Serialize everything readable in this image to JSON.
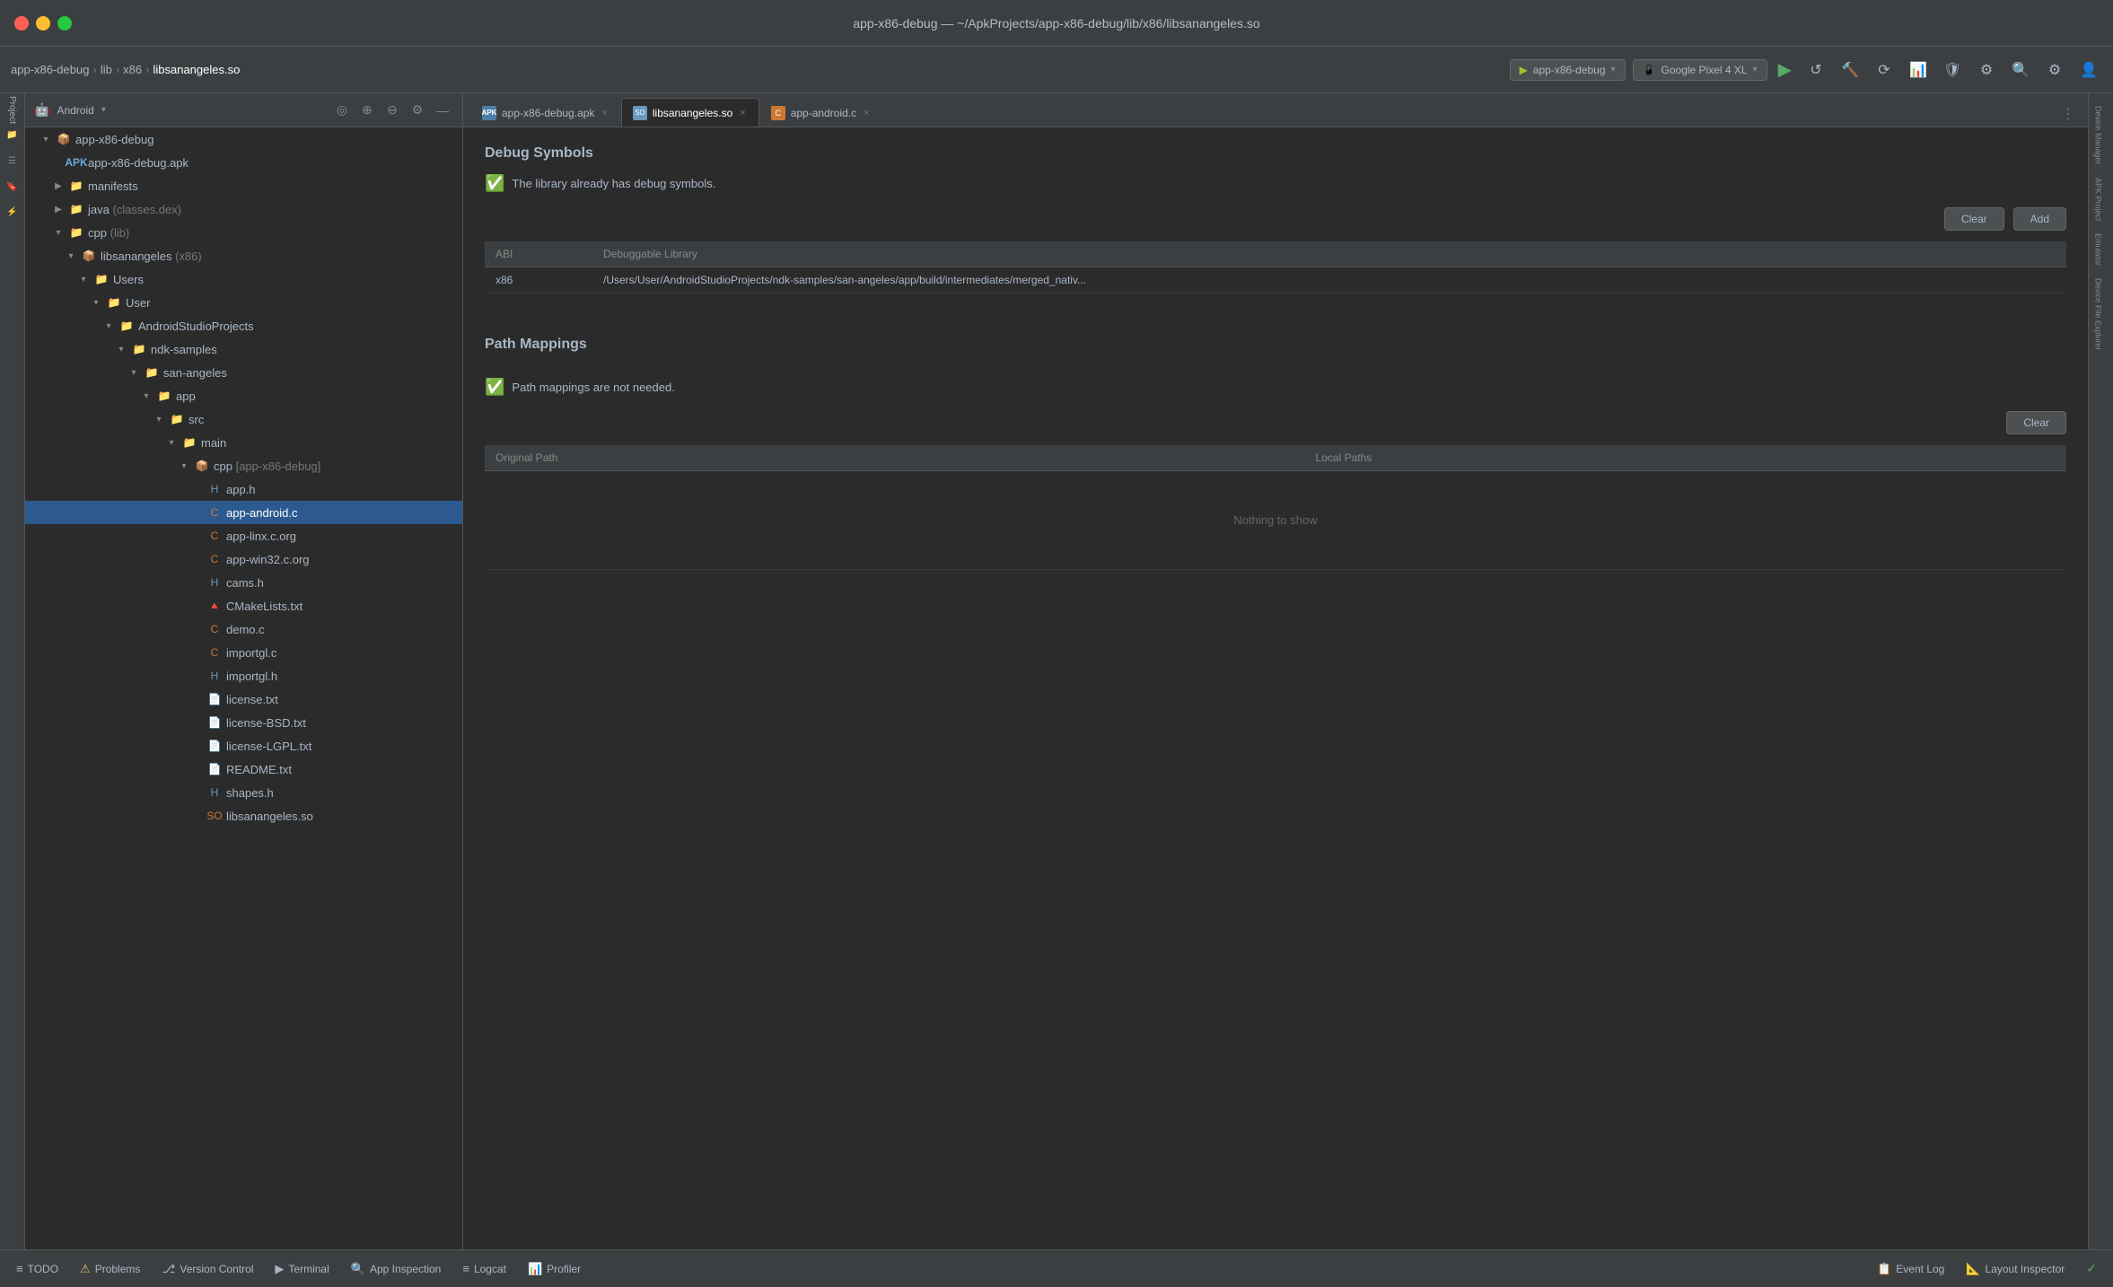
{
  "window": {
    "title": "app-x86-debug — ~/ApkProjects/app-x86-debug/lib/x86/libsanangeles.so"
  },
  "breadcrumb": {
    "items": [
      "app-x86-debug",
      "lib",
      "x86",
      "libsanangeles.so"
    ]
  },
  "toolbar": {
    "device": "app-x86-debug",
    "emulator": "Google Pixel 4 XL"
  },
  "panel": {
    "title": "Android",
    "dropdown_arrow": "▾"
  },
  "tabs": [
    {
      "label": "app-x86-debug.apk",
      "type": "apk",
      "icon": "APK",
      "closable": true
    },
    {
      "label": "libsanangeles.so",
      "type": "so",
      "icon": "SO",
      "closable": true,
      "active": true
    },
    {
      "label": "app-android.c",
      "type": "c",
      "icon": "C",
      "closable": true
    }
  ],
  "debug_symbols": {
    "title": "Debug Symbols",
    "status": "The library already has debug symbols.",
    "clear_btn": "Clear",
    "add_btn": "Add",
    "table": {
      "columns": [
        "ABI",
        "Debuggable Library"
      ],
      "rows": [
        {
          "abi": "x86",
          "library": "/Users/User/AndroidStudioProjects/ndk-samples/san-angeles/app/build/intermediates/merged_nativ..."
        }
      ]
    }
  },
  "path_mappings": {
    "title": "Path Mappings",
    "status": "Path mappings are not needed.",
    "clear_btn": "Clear",
    "table": {
      "columns": [
        "Original Path",
        "Local Paths"
      ],
      "empty_text": "Nothing to show"
    }
  },
  "file_tree": {
    "items": [
      {
        "id": "root",
        "label": "app-x86-debug",
        "indent": 0,
        "type": "module",
        "expanded": true,
        "has_arrow": true
      },
      {
        "id": "apk",
        "label": "app-x86-debug.apk",
        "indent": 1,
        "type": "apk",
        "has_arrow": false
      },
      {
        "id": "manifests",
        "label": "manifests",
        "indent": 1,
        "type": "folder",
        "expanded": false,
        "has_arrow": true
      },
      {
        "id": "java",
        "label": "java",
        "suffix": "(classes.dex)",
        "indent": 1,
        "type": "folder",
        "expanded": false,
        "has_arrow": true
      },
      {
        "id": "cpp",
        "label": "cpp",
        "suffix": "(lib)",
        "indent": 1,
        "type": "folder",
        "expanded": true,
        "has_arrow": true
      },
      {
        "id": "libsanangeles",
        "label": "libsanangeles",
        "suffix": "(x86)",
        "indent": 2,
        "type": "module",
        "expanded": true,
        "has_arrow": true
      },
      {
        "id": "users",
        "label": "Users",
        "indent": 3,
        "type": "folder",
        "expanded": true,
        "has_arrow": true
      },
      {
        "id": "user",
        "label": "User",
        "indent": 4,
        "type": "folder",
        "expanded": true,
        "has_arrow": true
      },
      {
        "id": "androidstudioprojects",
        "label": "AndroidStudioProjects",
        "indent": 5,
        "type": "folder",
        "expanded": true,
        "has_arrow": true
      },
      {
        "id": "ndk-samples",
        "label": "ndk-samples",
        "indent": 6,
        "type": "folder",
        "expanded": true,
        "has_arrow": true
      },
      {
        "id": "san-angeles",
        "label": "san-angeles",
        "indent": 7,
        "type": "folder",
        "expanded": true,
        "has_arrow": true
      },
      {
        "id": "app",
        "label": "app",
        "indent": 8,
        "type": "folder",
        "expanded": true,
        "has_arrow": true
      },
      {
        "id": "src",
        "label": "src",
        "indent": 9,
        "type": "folder",
        "expanded": true,
        "has_arrow": true
      },
      {
        "id": "main",
        "label": "main",
        "indent": 10,
        "type": "folder",
        "expanded": true,
        "has_arrow": true
      },
      {
        "id": "cpp-app-x86",
        "label": "cpp",
        "suffix": "[app-x86-debug]",
        "indent": 11,
        "type": "module",
        "expanded": true,
        "has_arrow": true
      },
      {
        "id": "app-h",
        "label": "app.h",
        "indent": 12,
        "type": "h",
        "has_arrow": false
      },
      {
        "id": "app-android-c",
        "label": "app-android.c",
        "indent": 12,
        "type": "c",
        "has_arrow": false,
        "selected": true
      },
      {
        "id": "app-linx-c-org",
        "label": "app-linx.c.org",
        "indent": 12,
        "type": "c",
        "has_arrow": false
      },
      {
        "id": "app-win32-c-org",
        "label": "app-win32.c.org",
        "indent": 12,
        "type": "c",
        "has_arrow": false
      },
      {
        "id": "cams-h",
        "label": "cams.h",
        "indent": 12,
        "type": "h",
        "has_arrow": false
      },
      {
        "id": "cmakelists",
        "label": "CMakeLists.txt",
        "indent": 12,
        "type": "cmake",
        "has_arrow": false
      },
      {
        "id": "demo-c",
        "label": "demo.c",
        "indent": 12,
        "type": "c",
        "has_arrow": false
      },
      {
        "id": "importgl-c",
        "label": "importgl.c",
        "indent": 12,
        "type": "c",
        "has_arrow": false
      },
      {
        "id": "importgl-h",
        "label": "importgl.h",
        "indent": 12,
        "type": "h",
        "has_arrow": false
      },
      {
        "id": "license-txt",
        "label": "license.txt",
        "indent": 12,
        "type": "txt",
        "has_arrow": false
      },
      {
        "id": "license-bsd-txt",
        "label": "license-BSD.txt",
        "indent": 12,
        "type": "txt",
        "has_arrow": false
      },
      {
        "id": "license-lgpl-txt",
        "label": "license-LGPL.txt",
        "indent": 12,
        "type": "txt",
        "has_arrow": false
      },
      {
        "id": "readme-txt",
        "label": "README.txt",
        "indent": 12,
        "type": "txt",
        "has_arrow": false
      },
      {
        "id": "shapes-h",
        "label": "shapes.h",
        "indent": 12,
        "type": "h",
        "has_arrow": false
      },
      {
        "id": "libsanangeles-so",
        "label": "libsanangeles.so",
        "indent": 12,
        "type": "so",
        "has_arrow": false
      }
    ]
  },
  "right_sidebar": {
    "items": [
      "Device Manager",
      "APK Project"
    ]
  },
  "bottom_bar": {
    "items": [
      {
        "icon": "≡",
        "label": "TODO"
      },
      {
        "icon": "⚠",
        "label": "Problems"
      },
      {
        "icon": "⎇",
        "label": "Version Control"
      },
      {
        "icon": "▶",
        "label": "Terminal"
      },
      {
        "icon": "🔍",
        "label": "App Inspection"
      },
      {
        "icon": "≡",
        "label": "Logcat"
      },
      {
        "icon": "📊",
        "label": "Profiler"
      }
    ],
    "right_items": [
      {
        "icon": "📋",
        "label": "Event Log"
      },
      {
        "icon": "📐",
        "label": "Layout Inspector"
      }
    ]
  }
}
